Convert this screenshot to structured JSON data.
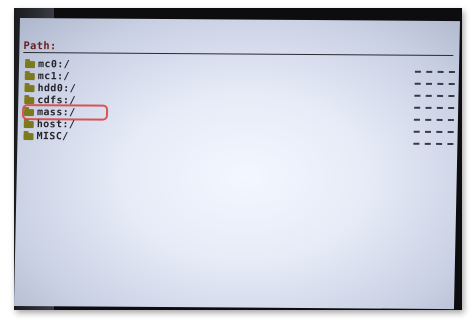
{
  "path": {
    "label": "Path:"
  },
  "entries": [
    {
      "name": "mc0:/",
      "size": "-----"
    },
    {
      "name": "mc1:/",
      "size": "-----"
    },
    {
      "name": "hdd0:/",
      "size": "-----"
    },
    {
      "name": "cdfs:/",
      "size": "-----"
    },
    {
      "name": "mass:/",
      "size": "-----",
      "highlighted": true
    },
    {
      "name": "host:/",
      "size": "-----"
    },
    {
      "name": "MISC/",
      "size": "-----"
    }
  ],
  "colors": {
    "highlight": "#d85454",
    "folder": "#7d7a1e",
    "path_label": "#6b1f1f"
  }
}
